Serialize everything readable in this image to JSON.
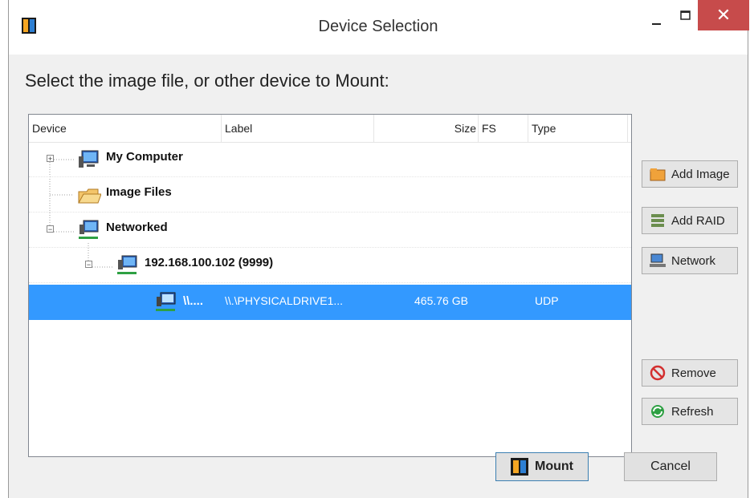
{
  "window": {
    "title": "Device Selection",
    "close_glyph": "✕"
  },
  "prompt": "Select the image file, or other device to Mount:",
  "columns": [
    "Device",
    "Label",
    "Size",
    "FS",
    "Type"
  ],
  "tree": {
    "my_computer": "My Computer",
    "image_files": "Image Files",
    "networked": "Networked",
    "host": "192.168.100.102 (9999)",
    "selected": {
      "device": "\\\\....",
      "label": "\\\\.\\PHYSICALDRIVE1...",
      "size": "465.76 GB",
      "fs": "",
      "type": "UDP"
    }
  },
  "side_buttons": {
    "add_image": "Add Image",
    "add_raid": "Add RAID",
    "network": "Network",
    "remove": "Remove",
    "refresh": "Refresh"
  },
  "bottom_buttons": {
    "mount": "Mount",
    "cancel": "Cancel"
  },
  "colors": {
    "selection": "#3399ff",
    "close": "#c74b4b"
  }
}
